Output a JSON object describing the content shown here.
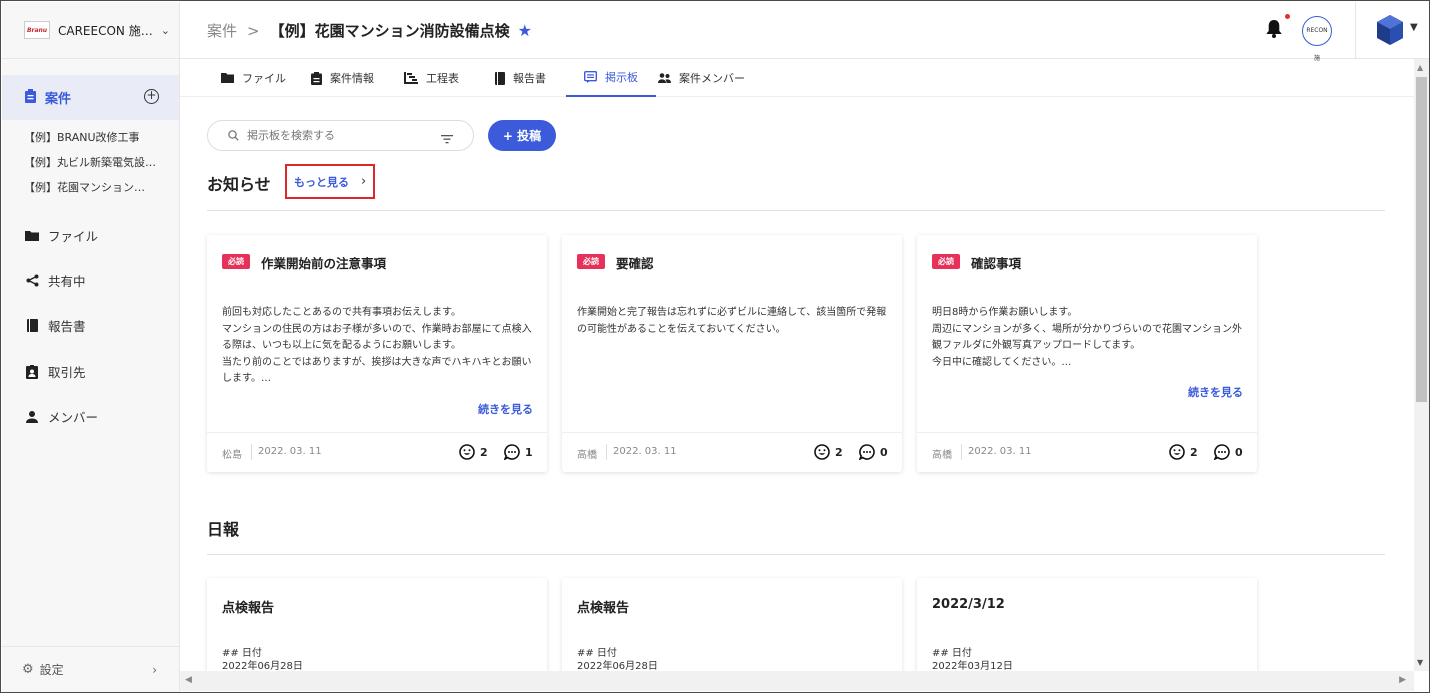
{
  "sidebar": {
    "org_name": "CAREECON 施…",
    "logo_text": "Branu",
    "active_label": "案件",
    "projects": [
      "【例】BRANU改修工事",
      "【例】丸ビル新築電気設…",
      "【例】花園マンション…"
    ],
    "nav": [
      "ファイル",
      "共有中",
      "報告書",
      "取引先",
      "メンバー"
    ],
    "settings_label": "設定"
  },
  "header": {
    "breadcrumb_root": "案件",
    "breadcrumb_sep": ">",
    "title": "【例】花園マンション消防設備点検",
    "recon_text": "RECON 施"
  },
  "tabs": [
    "ファイル",
    "案件情報",
    "工程表",
    "報告書",
    "掲示板",
    "案件メンバー"
  ],
  "active_tab": "掲示板",
  "toolbar": {
    "search_placeholder": "掲示板を検索する",
    "post_label": "+ 投稿"
  },
  "notices": {
    "section_title": "お知らせ",
    "more_label": "もっと見る",
    "badge": "必読",
    "readmore_label": "続きを見る",
    "cards": [
      {
        "title": "作業開始前の注意事項",
        "body": "前回も対応したことあるので共有事項お伝えします。\nマンションの住民の方はお子様が多いので、作業時お部屋にて点検入る際は、いつも以上に気を配るようにお願いします。\n当たり前のことではありますが、挨拶は大きな声でハキハキとお願いします。…",
        "author": "松島",
        "date": "2022. 03. 11",
        "smiles": "2",
        "comments": "1"
      },
      {
        "title": "要確認",
        "body": "作業開始と完了報告は忘れずに必ずビルに連絡して、該当箇所で発報の可能性があることを伝えておいてください。",
        "author": "高橋",
        "date": "2022. 03. 11",
        "smiles": "2",
        "comments": "0"
      },
      {
        "title": "確認事項",
        "body": "明日8時から作業お願いします。\n周辺にマンションが多く、場所が分かりづらいので花園マンション外観ファルダに外観写真アップロードしてます。\n今日中に確認してください。…",
        "author": "高橋",
        "date": "2022. 03. 11",
        "smiles": "2",
        "comments": "0"
      }
    ]
  },
  "daily": {
    "section_title": "日報",
    "cards": [
      {
        "title": "点検報告",
        "line1": "## 日付",
        "line2": "2022年06月28日"
      },
      {
        "title": "点検報告",
        "line1": "## 日付",
        "line2": "2022年06月28日"
      },
      {
        "title": "2022/3/12",
        "line1": "## 日付",
        "line2": "2022年03月12日"
      }
    ]
  },
  "colors": {
    "accent": "#3b5bdb",
    "badge": "#e8315a",
    "highlight_box": "#e0262b"
  }
}
